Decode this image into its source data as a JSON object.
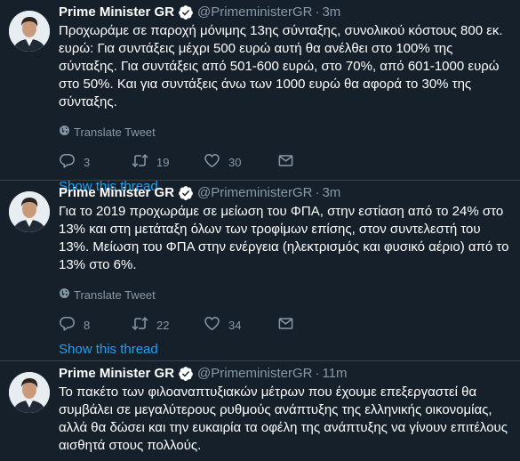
{
  "tweets": [
    {
      "name": "Prime Minister GR",
      "handle": "@PrimeministerGR",
      "dot": "·",
      "time": "3m",
      "text": "Προχωράμε σε παροχή μόνιμης 13ης σύνταξης, συνολικού κόστους 800 εκ. ευρώ: Για συντάξεις μέχρι 500 ευρώ αυτή θα ανέλθει στο 100% της σύνταξης. Για συντάξεις από 501-600 ευρώ, στο 70%, από 601-1000 ευρώ στο 50%. Και για συντάξεις άνω των 1000 ευρώ θα αφορά το 30% της σύνταξης.",
      "translate": "Translate Tweet",
      "replies": "3",
      "retweets": "19",
      "likes": "30",
      "show_thread": "Show this thread"
    },
    {
      "name": "Prime Minister GR",
      "handle": "@PrimeministerGR",
      "dot": "·",
      "time": "3m",
      "text": "Για το 2019 προχωράμε σε μείωση του ΦΠΑ, στην εστίαση από το 24% στο 13% και στη μετάταξη όλων των τροφίμων επίσης, στον συντελεστή του 13%. Μείωση του ΦΠΑ στην ενέργεια (ηλεκτρισμός και φυσικό αέριο) από το 13% στο 6%.",
      "translate": "Translate Tweet",
      "replies": "8",
      "retweets": "22",
      "likes": "34",
      "show_thread": "Show this thread"
    },
    {
      "name": "Prime Minister GR",
      "handle": "@PrimeministerGR",
      "dot": "·",
      "time": "11m",
      "text": "Το πακέτο των φιλοαναπτυξιακών μέτρων που έχουμε επεξεργαστεί θα συμβάλει σε μεγαλύτερους ρυθμούς ανάπτυξης της ελληνικής οικονομίας, αλλά θα δώσει και την ευκαιρία τα οφέλη της ανάπτυξης να γίνουν επιτέλους αισθητά στους πολλούς."
    }
  ],
  "colors": {
    "background": "#15202b",
    "text": "#ffffff",
    "secondary": "#8899a6",
    "link": "#1da1f2",
    "divider": "#38444d"
  },
  "icons": [
    "verified-badge-icon",
    "globe-icon",
    "reply-icon",
    "retweet-icon",
    "like-icon",
    "message-icon"
  ]
}
